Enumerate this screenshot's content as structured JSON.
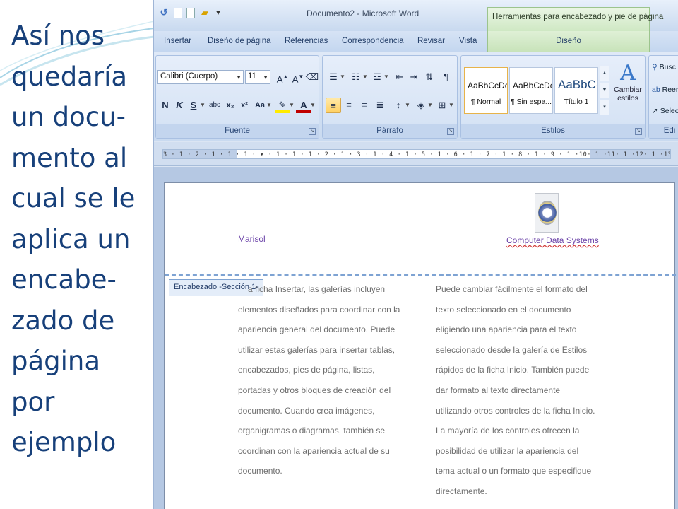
{
  "slide": {
    "caption_lines": [
      "Así nos",
      "quedaría",
      "un docu-",
      "mento al",
      "cual se le",
      "aplica un",
      "encabe-",
      "zado de",
      "página",
      "por",
      "ejemplo"
    ]
  },
  "word": {
    "window_title": "Documento2 - Microsoft Word",
    "context_tab_header": "Herramientas para encabezado y pie de página",
    "tabs": [
      "Insertar",
      "Diseño de página",
      "Referencias",
      "Correspondencia",
      "Revisar",
      "Vista"
    ],
    "context_tab": "Diseño",
    "groups": {
      "font_label": "Fuente",
      "paragraph_label": "Párrafo",
      "styles_label": "Estilos",
      "editing_label": "Edi"
    },
    "font": {
      "name": "Calibri (Cuerpo)",
      "size": "11",
      "bold": "N",
      "italic": "K",
      "underline": "S",
      "strike": "abc",
      "subscript": "x₂",
      "superscript": "x²",
      "case": "Aa"
    },
    "styles": [
      {
        "sample": "AaBbCcDc",
        "name": "¶ Normal"
      },
      {
        "sample": "AaBbCcDc",
        "name": "¶ Sin espa..."
      },
      {
        "sample": "AaBbC(",
        "name": "Título 1"
      }
    ],
    "change_styles_label_1": "Cambiar",
    "change_styles_label_2": "estilos",
    "editing": {
      "find": "Busc",
      "replace": "Reer",
      "select": "Selec"
    },
    "ruler_text": "3 · 1 · 2 · 1 · 1 · 1 · ▾ · 1 · 1 · 1 · 2 · 1 · 3 · 1 · 4 · 1 · 5 · 1 · 6 · 1 · 7 · 1 · 8 · 1 · 9 · 1 ·10· 1 ·11· 1 ·12· 1 ·13· 1 ·14· 1 · △ · 16 · 1 ·17· 1 ·",
    "header": {
      "left_text": "Marisol",
      "right_text": "Computer Data Systems",
      "tag": "Encabezado -Sección 1-"
    },
    "body_left": [
      "a ficha Insertar, las galerías incluyen",
      "elementos diseñados para coordinar con la",
      "apariencia general del documento. Puede",
      "utilizar estas galerías para insertar tablas,",
      "encabezados, pies de página, listas,",
      "portadas y otros bloques de creación del",
      "documento. Cuando crea imágenes,",
      "organigramas o diagramas, también se",
      "coordinan con la apariencia actual de su",
      "documento."
    ],
    "body_right": [
      "Puede cambiar fácilmente el formato del",
      "texto seleccionado en el documento",
      "eligiendo una apariencia para el texto",
      "seleccionado desde la galería de Estilos",
      "rápidos de la ficha Inicio. También puede",
      "dar formato al texto directamente",
      "utilizando otros controles de la ficha Inicio.",
      "La mayoría de los controles ofrecen la",
      "posibilidad de utilizar la apariencia del",
      "tema actual o un formato que especifique",
      "directamente."
    ]
  }
}
